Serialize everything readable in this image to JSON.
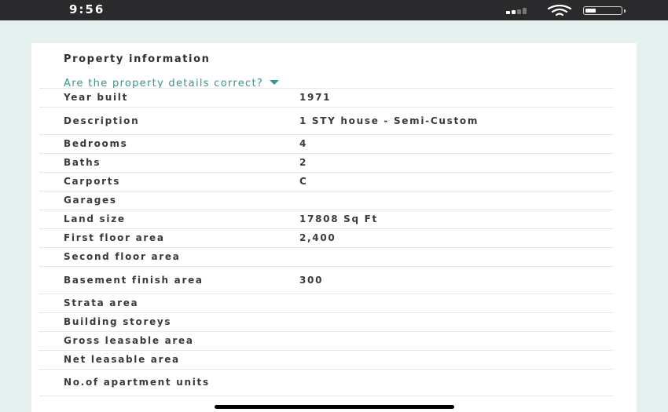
{
  "status_bar": {
    "time": "9:56",
    "icons": [
      "cellular-signal-icon",
      "wifi-icon",
      "battery-icon"
    ]
  },
  "section": {
    "title": "Property information",
    "details_link": "Are the property details correct?",
    "details_link_icon": "caret-down-icon",
    "accent_color": "#3a9488"
  },
  "rows": [
    {
      "label": "Year built",
      "value": "1971"
    },
    {
      "label": "Description",
      "value": "1 STY house - Semi-Custom"
    },
    {
      "label": "Bedrooms",
      "value": "4"
    },
    {
      "label": "Baths",
      "value": "2"
    },
    {
      "label": "Carports",
      "value": "C"
    },
    {
      "label": "Garages",
      "value": ""
    },
    {
      "label": "Land size",
      "value": "17808 Sq Ft"
    },
    {
      "label": "First floor area",
      "value": "2,400"
    },
    {
      "label": "Second floor area",
      "value": ""
    },
    {
      "label": "Basement finish area",
      "value": "300"
    },
    {
      "label": "Strata area",
      "value": ""
    },
    {
      "label": "Building storeys",
      "value": ""
    },
    {
      "label": "Gross leasable area",
      "value": ""
    },
    {
      "label": "Net leasable area",
      "value": ""
    },
    {
      "label": "No.of apartment units",
      "value": ""
    }
  ]
}
